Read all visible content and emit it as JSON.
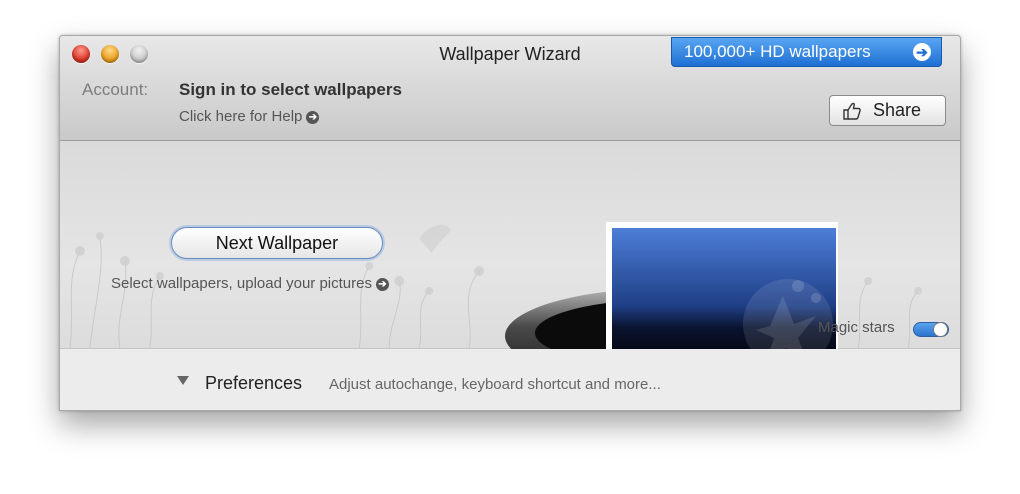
{
  "window": {
    "title": "Wallpaper Wizard"
  },
  "promo": {
    "label": "100,000+ HD wallpapers",
    "icon": "arrow-right-circle-icon",
    "color": "#1e6fd3"
  },
  "account": {
    "label": "Account:",
    "status": "Sign in to select wallpapers",
    "help_link": "Click here for Help"
  },
  "share": {
    "label": "Share",
    "icon": "thumbs-up-icon"
  },
  "main": {
    "next_button": "Next Wallpaper",
    "upload_link": "Select wallpapers, upload your pictures",
    "magic_stars": {
      "label": "Magic stars",
      "enabled": true
    }
  },
  "preferences": {
    "label": "Preferences",
    "description": "Adjust autochange, keyboard shortcut and more..."
  }
}
